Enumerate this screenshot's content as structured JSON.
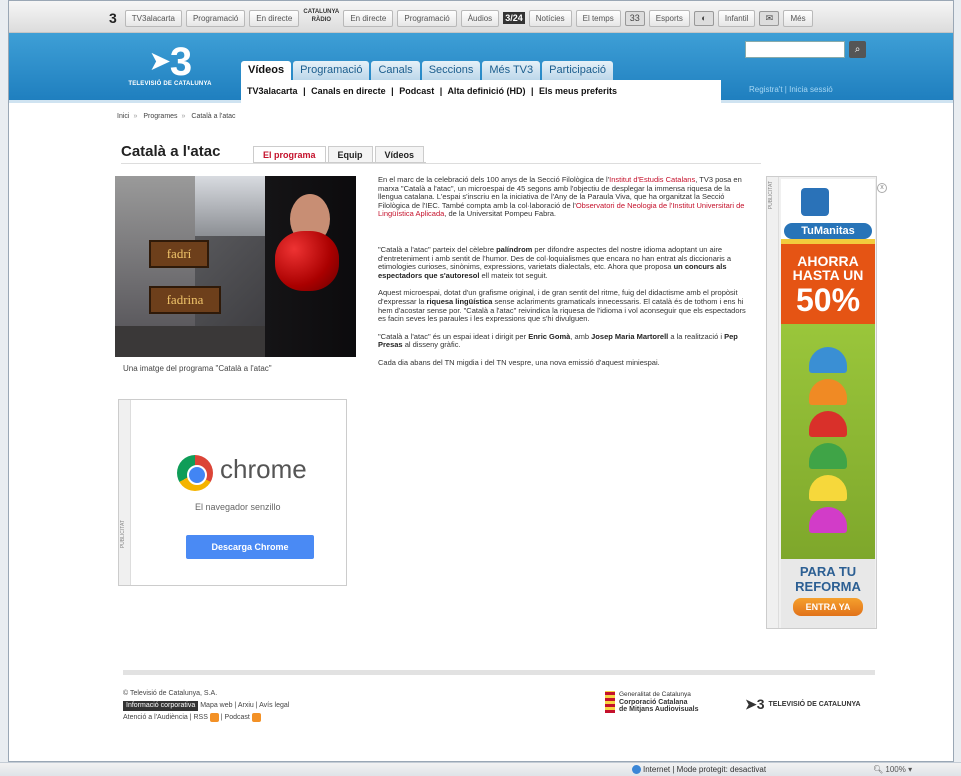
{
  "topbar": {
    "logo": "3",
    "items": [
      "TV3alacarta",
      "Programació",
      "En directe",
      "Catalunya Ràdio",
      "En directe",
      "Programació",
      "Àudios",
      "3/24",
      "Notícies",
      "El temps",
      "33",
      "Esports",
      "Infantil",
      "Més"
    ],
    "radio_line1": "CATALUNYA",
    "radio_line2": "RÀDIO"
  },
  "header": {
    "logo_mark": "3",
    "logo_sub": "TELEVISIÓ DE CATALUNYA",
    "tabs": [
      "Vídeos",
      "Programació",
      "Canals",
      "Seccions",
      "Més TV3",
      "Participació"
    ],
    "subnav": [
      "TV3alacarta",
      "|",
      "Canals en directe",
      "|",
      "Podcast",
      "|",
      "Alta definició (HD)",
      "|",
      "Els meus preferits"
    ],
    "search_placeholder": "",
    "register": "Registra't",
    "login": "Inicia sessió"
  },
  "breadcrumb": [
    "Inici",
    "Programes",
    "Català a l'atac"
  ],
  "page": {
    "title": "Català a l'atac",
    "tabs": [
      "El programa",
      "Equip",
      "Vídeos"
    ]
  },
  "photo": {
    "sign1": "fadrí",
    "sign2": "fadrina",
    "caption": "Una imatge del programa \"Català a l'atac\""
  },
  "ad_chrome": {
    "side_label": "PUBLICITAT",
    "word": "chrome",
    "subtitle": "El navegador senzillo",
    "button": "Descarga Chrome"
  },
  "article": {
    "p1a": "En el marc de la celebració dels 100 anys de la Secció Filològica de l'",
    "p1link1": "Institut d'Estudis Catalans",
    "p1b": ", TV3 posa en marxa \"Català a l'atac\", un microespai de 45 segons amb l'objectiu de desplegar la immensa riquesa de la llengua catalana. L'espai s'inscriu en la iniciativa de l'Any de la Paraula Viva, que ha organitzat la Secció Filològica de l'IEC. També compta amb la col·laboració de l'",
    "p1link2": "Observatori de Neologia de l'Institut Universitari de Lingüística Aplicada",
    "p1c": ", de la Universitat Pompeu Fabra.",
    "p2a": "\"Català a l'atac\" parteix del cèlebre ",
    "p2b1": "palíndrom",
    "p2b": " per difondre aspectes del nostre idioma adoptant un aire d'entreteniment i amb sentit de l'humor. Des de col·loquialismes que encara no han entrat als diccionaris a etimologies curioses, sinònims, expressions, varietats dialectals, etc. Ahora que proposa ",
    "p2b2": "un concurs als espectadors que s'autoresol",
    "p2c": " ell mateix tot seguit.",
    "p3a": "Aquest microespai, dotat d'un grafisme original, i de gran sentit del ritme, fuig del didactisme amb el propòsit d'expressar la ",
    "p3b1": "riquesa lingüística",
    "p3b": " sense aclariments gramaticals innecessaris. El català és de tothom i ens hi hem d'acostar sense por. \"Català a l'atac\" reivindica la riquesa de l'idioma i vol aconseguir que els espectadors es facin seves les paraules i les expressions que s'hi divulguen.",
    "p4a": "\"Català a l'atac\" és un espai ideat i dirigit per ",
    "p4b1": "Enric Gomà",
    "p4b": ", amb ",
    "p4b2": "Josep Maria Martorell",
    "p4c": " a la realització i ",
    "p4b3": "Pep Presas",
    "p4d": " al disseny gràfic.",
    "p5": "Cada dia abans del TN migdia i del TN vespre, una nova emissió d'aquest miniespai."
  },
  "ad_tumanitas": {
    "side_label": "PUBLICITAT",
    "close": "x",
    "logo": "TuManitas",
    "ahorra1": "AHORRA",
    "ahorra2": "HASTA UN",
    "pct": "50%",
    "para1": "PARA TU",
    "para2": "REFORMA",
    "button": "ENTRA YA",
    "helmet_colors": [
      "#3a8fd4",
      "#f08a24",
      "#d9302a",
      "#3fa447",
      "#f6d83b",
      "#d23cc8"
    ]
  },
  "footer": {
    "copyright": "© Televisió de Catalunya, S.A.",
    "badge": "Informació corporativa",
    "links1": "Mapa web | Arxiu | Avís legal",
    "links2": "Atenció a l'Audiència | RSS",
    "podcast": "| Podcast",
    "gen1": "Generalitat de Catalunya",
    "gen2": "Corporació Catalana",
    "gen3": "de Mitjans Audiovisuals",
    "tv3": "TELEVISIÓ DE CATALUNYA",
    "tv3mark": "3"
  },
  "statusbar": {
    "zone": "Internet | Mode protegit: desactivat",
    "zoom": "100%"
  }
}
